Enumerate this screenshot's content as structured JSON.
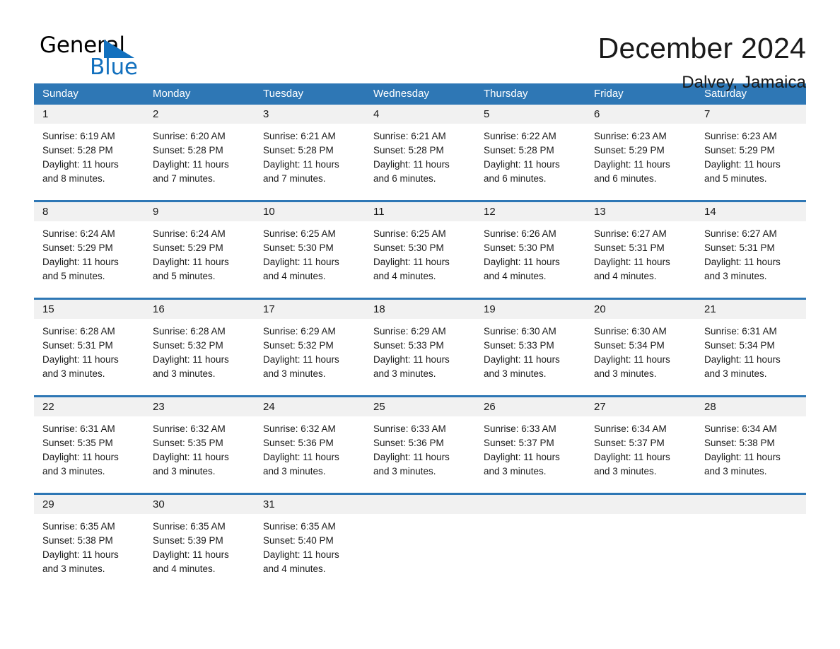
{
  "brand": {
    "name_part1": "General",
    "name_part2": "Blue",
    "flag_icon": "triangle-flag-icon",
    "accent_color": "#1270BE"
  },
  "header": {
    "title": "December 2024",
    "location": "Dalvey, Jamaica"
  },
  "theme": {
    "header_blue": "#2E77B5",
    "day_band_gray": "#F1F1F1",
    "text_color": "#1a1a1a"
  },
  "calendar": {
    "weekdays": [
      "Sunday",
      "Monday",
      "Tuesday",
      "Wednesday",
      "Thursday",
      "Friday",
      "Saturday"
    ],
    "weeks": [
      [
        {
          "day": "1",
          "sunrise": "Sunrise: 6:19 AM",
          "sunset": "Sunset: 5:28 PM",
          "daylight": "Daylight: 11 hours and 8 minutes."
        },
        {
          "day": "2",
          "sunrise": "Sunrise: 6:20 AM",
          "sunset": "Sunset: 5:28 PM",
          "daylight": "Daylight: 11 hours and 7 minutes."
        },
        {
          "day": "3",
          "sunrise": "Sunrise: 6:21 AM",
          "sunset": "Sunset: 5:28 PM",
          "daylight": "Daylight: 11 hours and 7 minutes."
        },
        {
          "day": "4",
          "sunrise": "Sunrise: 6:21 AM",
          "sunset": "Sunset: 5:28 PM",
          "daylight": "Daylight: 11 hours and 6 minutes."
        },
        {
          "day": "5",
          "sunrise": "Sunrise: 6:22 AM",
          "sunset": "Sunset: 5:28 PM",
          "daylight": "Daylight: 11 hours and 6 minutes."
        },
        {
          "day": "6",
          "sunrise": "Sunrise: 6:23 AM",
          "sunset": "Sunset: 5:29 PM",
          "daylight": "Daylight: 11 hours and 6 minutes."
        },
        {
          "day": "7",
          "sunrise": "Sunrise: 6:23 AM",
          "sunset": "Sunset: 5:29 PM",
          "daylight": "Daylight: 11 hours and 5 minutes."
        }
      ],
      [
        {
          "day": "8",
          "sunrise": "Sunrise: 6:24 AM",
          "sunset": "Sunset: 5:29 PM",
          "daylight": "Daylight: 11 hours and 5 minutes."
        },
        {
          "day": "9",
          "sunrise": "Sunrise: 6:24 AM",
          "sunset": "Sunset: 5:29 PM",
          "daylight": "Daylight: 11 hours and 5 minutes."
        },
        {
          "day": "10",
          "sunrise": "Sunrise: 6:25 AM",
          "sunset": "Sunset: 5:30 PM",
          "daylight": "Daylight: 11 hours and 4 minutes."
        },
        {
          "day": "11",
          "sunrise": "Sunrise: 6:25 AM",
          "sunset": "Sunset: 5:30 PM",
          "daylight": "Daylight: 11 hours and 4 minutes."
        },
        {
          "day": "12",
          "sunrise": "Sunrise: 6:26 AM",
          "sunset": "Sunset: 5:30 PM",
          "daylight": "Daylight: 11 hours and 4 minutes."
        },
        {
          "day": "13",
          "sunrise": "Sunrise: 6:27 AM",
          "sunset": "Sunset: 5:31 PM",
          "daylight": "Daylight: 11 hours and 4 minutes."
        },
        {
          "day": "14",
          "sunrise": "Sunrise: 6:27 AM",
          "sunset": "Sunset: 5:31 PM",
          "daylight": "Daylight: 11 hours and 3 minutes."
        }
      ],
      [
        {
          "day": "15",
          "sunrise": "Sunrise: 6:28 AM",
          "sunset": "Sunset: 5:31 PM",
          "daylight": "Daylight: 11 hours and 3 minutes."
        },
        {
          "day": "16",
          "sunrise": "Sunrise: 6:28 AM",
          "sunset": "Sunset: 5:32 PM",
          "daylight": "Daylight: 11 hours and 3 minutes."
        },
        {
          "day": "17",
          "sunrise": "Sunrise: 6:29 AM",
          "sunset": "Sunset: 5:32 PM",
          "daylight": "Daylight: 11 hours and 3 minutes."
        },
        {
          "day": "18",
          "sunrise": "Sunrise: 6:29 AM",
          "sunset": "Sunset: 5:33 PM",
          "daylight": "Daylight: 11 hours and 3 minutes."
        },
        {
          "day": "19",
          "sunrise": "Sunrise: 6:30 AM",
          "sunset": "Sunset: 5:33 PM",
          "daylight": "Daylight: 11 hours and 3 minutes."
        },
        {
          "day": "20",
          "sunrise": "Sunrise: 6:30 AM",
          "sunset": "Sunset: 5:34 PM",
          "daylight": "Daylight: 11 hours and 3 minutes."
        },
        {
          "day": "21",
          "sunrise": "Sunrise: 6:31 AM",
          "sunset": "Sunset: 5:34 PM",
          "daylight": "Daylight: 11 hours and 3 minutes."
        }
      ],
      [
        {
          "day": "22",
          "sunrise": "Sunrise: 6:31 AM",
          "sunset": "Sunset: 5:35 PM",
          "daylight": "Daylight: 11 hours and 3 minutes."
        },
        {
          "day": "23",
          "sunrise": "Sunrise: 6:32 AM",
          "sunset": "Sunset: 5:35 PM",
          "daylight": "Daylight: 11 hours and 3 minutes."
        },
        {
          "day": "24",
          "sunrise": "Sunrise: 6:32 AM",
          "sunset": "Sunset: 5:36 PM",
          "daylight": "Daylight: 11 hours and 3 minutes."
        },
        {
          "day": "25",
          "sunrise": "Sunrise: 6:33 AM",
          "sunset": "Sunset: 5:36 PM",
          "daylight": "Daylight: 11 hours and 3 minutes."
        },
        {
          "day": "26",
          "sunrise": "Sunrise: 6:33 AM",
          "sunset": "Sunset: 5:37 PM",
          "daylight": "Daylight: 11 hours and 3 minutes."
        },
        {
          "day": "27",
          "sunrise": "Sunrise: 6:34 AM",
          "sunset": "Sunset: 5:37 PM",
          "daylight": "Daylight: 11 hours and 3 minutes."
        },
        {
          "day": "28",
          "sunrise": "Sunrise: 6:34 AM",
          "sunset": "Sunset: 5:38 PM",
          "daylight": "Daylight: 11 hours and 3 minutes."
        }
      ],
      [
        {
          "day": "29",
          "sunrise": "Sunrise: 6:35 AM",
          "sunset": "Sunset: 5:38 PM",
          "daylight": "Daylight: 11 hours and 3 minutes."
        },
        {
          "day": "30",
          "sunrise": "Sunrise: 6:35 AM",
          "sunset": "Sunset: 5:39 PM",
          "daylight": "Daylight: 11 hours and 4 minutes."
        },
        {
          "day": "31",
          "sunrise": "Sunrise: 6:35 AM",
          "sunset": "Sunset: 5:40 PM",
          "daylight": "Daylight: 11 hours and 4 minutes."
        },
        {
          "day": "",
          "sunrise": "",
          "sunset": "",
          "daylight": ""
        },
        {
          "day": "",
          "sunrise": "",
          "sunset": "",
          "daylight": ""
        },
        {
          "day": "",
          "sunrise": "",
          "sunset": "",
          "daylight": ""
        },
        {
          "day": "",
          "sunrise": "",
          "sunset": "",
          "daylight": ""
        }
      ]
    ]
  }
}
